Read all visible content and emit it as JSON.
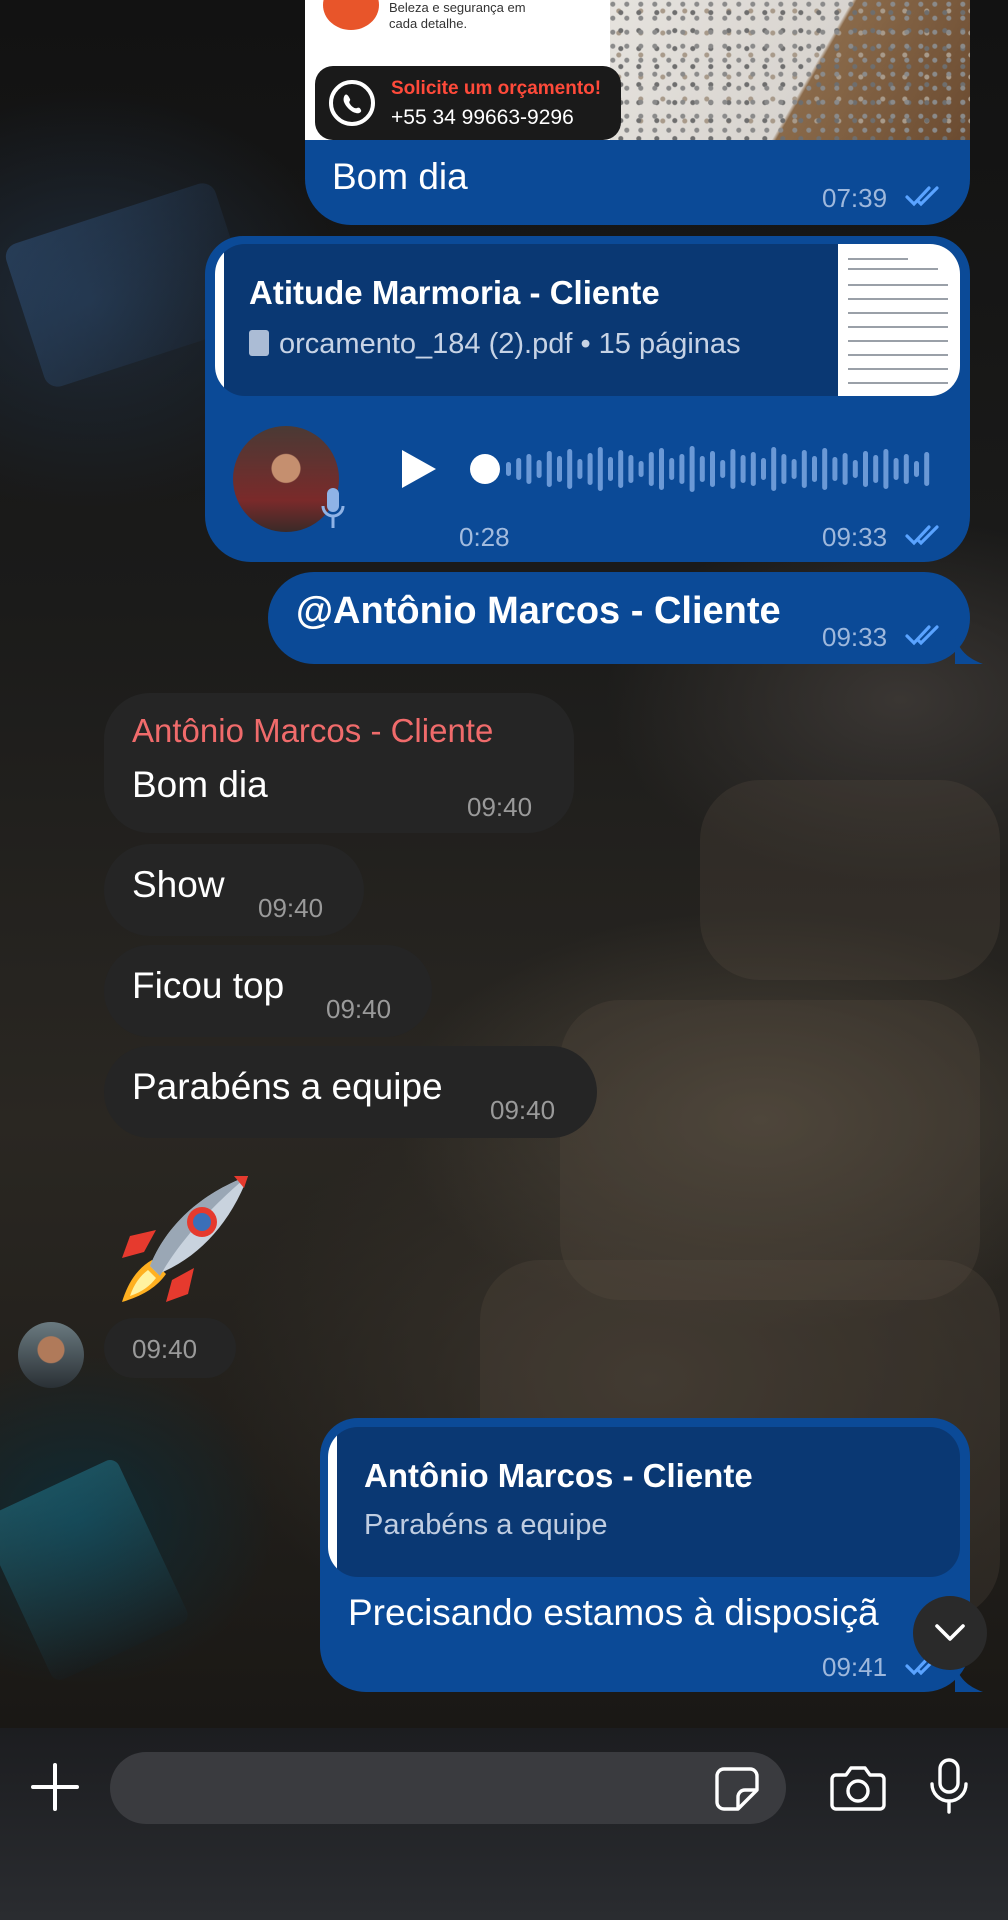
{
  "colors": {
    "outgoing_bubble": "#0b4a97",
    "incoming_bubble": "#252525",
    "quote_bg": "#0a3873",
    "sender_name": "#f06b6b",
    "read_ticks": "#5aa3ff"
  },
  "messages": {
    "ad": {
      "tagline": "Beleza e segurança em cada detalhe.",
      "cta_title": "Solicite um orçamento!",
      "cta_phone": "+55 34 99663-9296",
      "caption": "Bom dia",
      "time": "07:39"
    },
    "document": {
      "title": "Atitude Marmoria - Cliente",
      "file_meta": "orcamento_184 (2).pdf • 15 páginas"
    },
    "voice": {
      "duration": "0:28",
      "time": "09:33"
    },
    "mention": {
      "text": "@Antônio Marcos - Cliente",
      "time": "09:33"
    },
    "incoming": [
      {
        "sender": "Antônio Marcos - Cliente",
        "text": "Bom dia",
        "time": "09:40"
      },
      {
        "text": "Show",
        "time": "09:40"
      },
      {
        "text": "Ficou top",
        "time": "09:40"
      },
      {
        "text": "Parabéns a equipe",
        "time": "09:40"
      },
      {
        "emoji": "rocket",
        "time": "09:40"
      }
    ],
    "reply": {
      "quoted_author": "Antônio Marcos - Cliente",
      "quoted_text": "Parabéns a equipe",
      "text": "Precisando estamos à disposiçã",
      "time": "09:41"
    }
  },
  "composer": {
    "placeholder": ""
  },
  "icons": [
    "plus-icon",
    "sticker-icon",
    "camera-icon",
    "microphone-icon",
    "chevron-down-icon",
    "play-icon",
    "file-icon",
    "read-ticks-icon",
    "whatsapp-icon",
    "rocket-icon"
  ]
}
